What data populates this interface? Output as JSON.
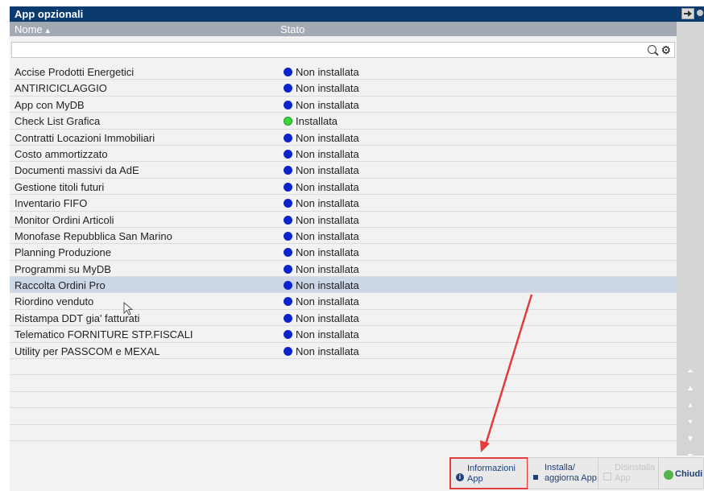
{
  "window": {
    "title": "App opzionali"
  },
  "columns": {
    "name": "Nome",
    "status": "Stato",
    "sort_indicator": "▲"
  },
  "filter": {
    "value": "",
    "placeholder": ""
  },
  "status_labels": {
    "off": "Non installata",
    "on": "Installata"
  },
  "rows": [
    {
      "name": "Accise Prodotti Energetici",
      "status": "Non installata",
      "installed": false,
      "selected": false
    },
    {
      "name": "ANTIRICICLAGGIO",
      "status": "Non installata",
      "installed": false,
      "selected": false
    },
    {
      "name": "App con MyDB",
      "status": "Non installata",
      "installed": false,
      "selected": false
    },
    {
      "name": "Check List Grafica",
      "status": "Installata",
      "installed": true,
      "selected": false
    },
    {
      "name": "Contratti Locazioni Immobiliari",
      "status": "Non installata",
      "installed": false,
      "selected": false
    },
    {
      "name": "Costo ammortizzato",
      "status": "Non installata",
      "installed": false,
      "selected": false
    },
    {
      "name": "Documenti massivi da AdE",
      "status": "Non installata",
      "installed": false,
      "selected": false
    },
    {
      "name": "Gestione titoli futuri",
      "status": "Non installata",
      "installed": false,
      "selected": false
    },
    {
      "name": "Inventario FIFO",
      "status": "Non installata",
      "installed": false,
      "selected": false
    },
    {
      "name": "Monitor Ordini Articoli",
      "status": "Non installata",
      "installed": false,
      "selected": false
    },
    {
      "name": "Monofase Repubblica San Marino",
      "status": "Non installata",
      "installed": false,
      "selected": false
    },
    {
      "name": "Planning Produzione",
      "status": "Non installata",
      "installed": false,
      "selected": false
    },
    {
      "name": "Programmi su MyDB",
      "status": "Non installata",
      "installed": false,
      "selected": false
    },
    {
      "name": "Raccolta Ordini Pro",
      "status": "Non installata",
      "installed": false,
      "selected": true
    },
    {
      "name": "Riordino venduto",
      "status": "Non installata",
      "installed": false,
      "selected": false
    },
    {
      "name": "Ristampa DDT gia' fatturati",
      "status": "Non installata",
      "installed": false,
      "selected": false
    },
    {
      "name": "Telematico FORNITURE STP.FISCALI",
      "status": "Non installata",
      "installed": false,
      "selected": false
    },
    {
      "name": "Utility per PASSCOM e MEXAL",
      "status": "Non installata",
      "installed": false,
      "selected": false
    }
  ],
  "footer": {
    "info_label": "Informazioni\nApp",
    "install_label": "Installa/\naggiorna App",
    "uninstall_label": "Disinstalla\nApp",
    "close_label": "Chiudi"
  },
  "colors": {
    "titlebar": "#0a3a6e",
    "header": "#a3aab3",
    "selected_row": "#cdd8e6",
    "not_installed_dot": "#0b24c9",
    "installed_dot": "#3ed43e",
    "annotation_red": "#e23c3c"
  },
  "icons": {
    "search": "search-icon",
    "settings": "gear-icon",
    "info": "info-icon",
    "close": "check-circle-icon",
    "pin": "pin-icon",
    "cursor": "mouse-cursor-icon"
  }
}
